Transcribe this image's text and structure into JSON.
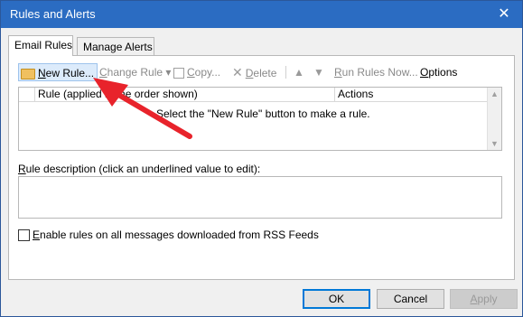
{
  "window": {
    "title": "Rules and Alerts",
    "close_glyph": "✕"
  },
  "tabs": [
    {
      "label": "Email Rules",
      "active": true
    },
    {
      "label": "Manage Alerts",
      "active": false
    }
  ],
  "toolbar": {
    "new_rule_pre": "",
    "new_rule_accel": "N",
    "new_rule_post": "ew Rule...",
    "change_rule_pre": "",
    "change_rule_accel": "C",
    "change_rule_post": "hange Rule ▾",
    "copy_pre": "",
    "copy_accel": "C",
    "copy_post": "opy...",
    "delete_pre": "",
    "delete_accel": "D",
    "delete_post": "elete",
    "move_up": "▲",
    "move_down": "▼",
    "run_pre": "",
    "run_accel": "R",
    "run_post": "un Rules Now...",
    "options_pre": "",
    "options_accel": "O",
    "options_post": "ptions"
  },
  "rules_list": {
    "columns": [
      "Rule (applied in the order shown)",
      "Actions"
    ],
    "empty_message": "Select the \"New Rule\" button to make a rule."
  },
  "description": {
    "label_pre": "",
    "label_accel": "R",
    "label_post": "ule description (click an underlined value to edit):"
  },
  "rss": {
    "checked": false,
    "label_pre": "",
    "label_accel": "E",
    "label_post": "nable rules on all messages downloaded from RSS Feeds"
  },
  "buttons": {
    "ok": "OK",
    "cancel": "Cancel",
    "apply_pre": "",
    "apply_accel": "A",
    "apply_post": "pply"
  },
  "colors": {
    "titlebar": "#2b6cc2",
    "annotation_arrow": "#e8232b"
  }
}
